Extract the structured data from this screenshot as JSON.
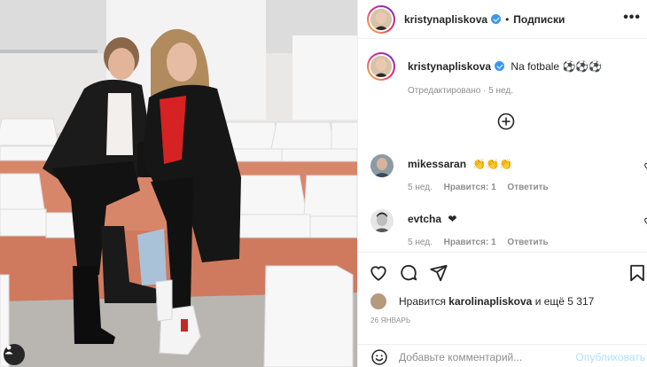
{
  "post": {
    "username": "kristynapliskova",
    "dot": "•",
    "follow_label": "Подписки",
    "more_icon": "more-icon"
  },
  "caption": {
    "username": "kristynapliskova",
    "text": "Na fotbale ⚽⚽⚽",
    "meta": "Отредактировано · 5 нед."
  },
  "comments": [
    {
      "username": "mikessaran",
      "text": "👏👏👏",
      "time": "5 нед.",
      "likes": "Нравится: 1",
      "reply": "Ответить"
    },
    {
      "username": "evtcha",
      "text": "❤",
      "time": "5 нед.",
      "likes": "Нравится: 1",
      "reply": "Ответить"
    }
  ],
  "likes": {
    "prefix": "Нравится",
    "user": "karolinapliskova",
    "suffix": "и ещё 5 317"
  },
  "date": "26 ЯНВАРЬ",
  "add_comment": {
    "placeholder": "Добавьте комментарий...",
    "publish_label": "Опубликовать"
  },
  "colors": {
    "verified": "#3897f0",
    "publish_disabled": "#b2dffc",
    "muted": "#8e8e8e"
  }
}
